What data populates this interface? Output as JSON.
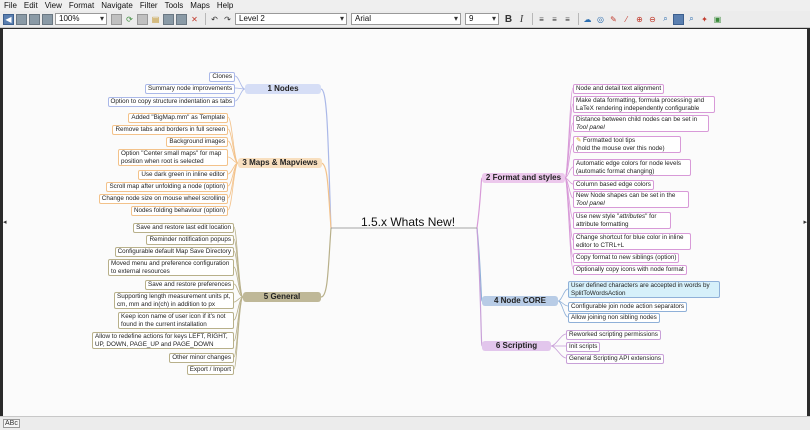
{
  "menu": [
    "File",
    "Edit",
    "View",
    "Format",
    "Navigate",
    "Filter",
    "Tools",
    "Maps",
    "Help"
  ],
  "toolbar": {
    "zoom": "100%",
    "level": "Level 2",
    "font": "Arial",
    "font_size": "9",
    "bold_label": "B",
    "italic_label": "I"
  },
  "map": {
    "root": "1.5.x Whats New!",
    "branches": {
      "nodes": {
        "label": "1 Nodes",
        "items": [
          "Clones",
          "Summary node improvements",
          "Option to copy structure indentation as tabs"
        ]
      },
      "maps": {
        "label": "3 Maps & Mapviews",
        "items": [
          "Added \"BigMap.mm\" as Template",
          "Remove tabs and borders in full screen",
          "Background images",
          "Option \"Center small maps\" for map position when root is selected",
          "Use dark green in inline editor",
          "Scroll map after unfolding a node (option)",
          "Change node size on mouse wheel scrolling",
          "Nodes folding behaviour (option)"
        ]
      },
      "general": {
        "label": "5 General",
        "items": [
          "Save and restore last edit location",
          "Reminder notification popups",
          "Configurable default Map Save Directory",
          "Moved menu and preference configuration to external resources",
          "Save and restore preferences",
          "Supporting length measurement units pt, cm, mm and in(ch) in addition to px",
          "Keep icon name of user icon if it's not found in the current installation",
          "Allow to redefine actions for keys LEFT, RIGHT, UP, DOWN, PAGE_UP and PAGE_DOWN",
          "Other minor changes",
          "Export / Import"
        ]
      },
      "format": {
        "label": "2 Format and styles",
        "items": [
          "Node and detail text alignment",
          "Make data formatting, formula processing and LaTeX rendering independently configurable",
          "Distance between child nodes can be set in",
          "Tool panel",
          "Formatted tool tips",
          "(hold the mouse over this node)",
          "Automatic edge colors for node levels (automatic format changing)",
          "Column based edge colors",
          "New Node shapes can be set in the",
          "Tool panel",
          "Use new style \"",
          "attributes",
          "\" for attribute formatting",
          "Change shortcut for blue color in inline editor to CTRL+L",
          "Copy format to new siblings (option)",
          "Optionally copy icons with node format"
        ]
      },
      "core": {
        "label": "4 Node CORE",
        "items": [
          "User defined characters are accepted in words by SplitToWordsAction",
          "Configurable join node action separators",
          "Allow joining non sibling nodes"
        ]
      },
      "scripting": {
        "label": "6 Scripting",
        "items": [
          "Reworked scripting permissions",
          "Init scripts",
          "General Scripting API extensions"
        ]
      }
    }
  },
  "status": "ABc",
  "colors": {
    "nodes": "#aab8e8",
    "maps": "#f3c28a",
    "general": "#b8b08a",
    "format": "#d89ad8",
    "core": "#8fb0d8",
    "scripting": "#c8a0d8"
  }
}
